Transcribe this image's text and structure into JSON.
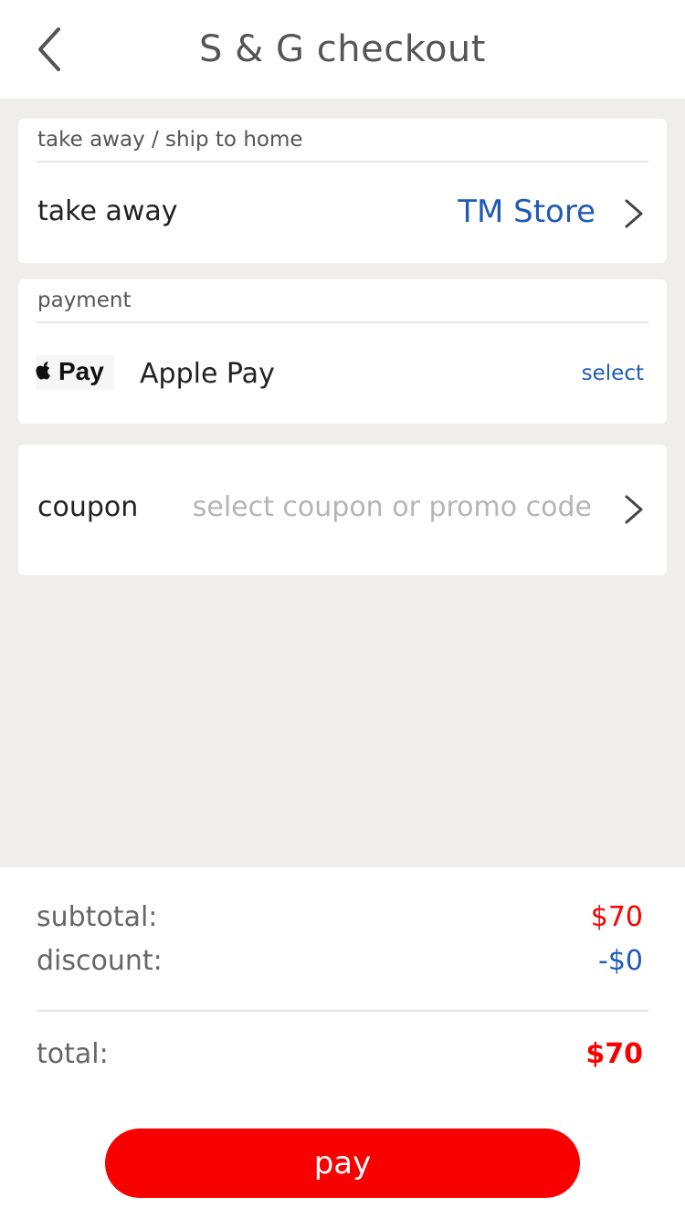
{
  "nav": {
    "title": "S & G checkout",
    "back_icon": "chevron-left-icon"
  },
  "delivery": {
    "header": "take away / ship to home",
    "mode_label": "take away",
    "store_name": "TM Store",
    "chevron_icon": "chevron-right-icon"
  },
  "payment": {
    "header": "payment",
    "method_logo": "apple-pay-logo",
    "method_logo_text": "Pay",
    "method_name": "Apple Pay",
    "select_label": "select"
  },
  "coupon": {
    "label": "coupon",
    "placeholder": "select coupon or promo code",
    "chevron_icon": "chevron-right-icon"
  },
  "summary": {
    "subtotal_label": "subtotal:",
    "subtotal_value": "$70",
    "discount_label": "discount:",
    "discount_value": "-$0",
    "total_label": "total:",
    "total_value": "$70"
  },
  "actions": {
    "pay_label": "pay"
  },
  "colors": {
    "accent_red": "#f80000",
    "link_blue": "#1f5bb5",
    "page_background": "#efeeec"
  }
}
